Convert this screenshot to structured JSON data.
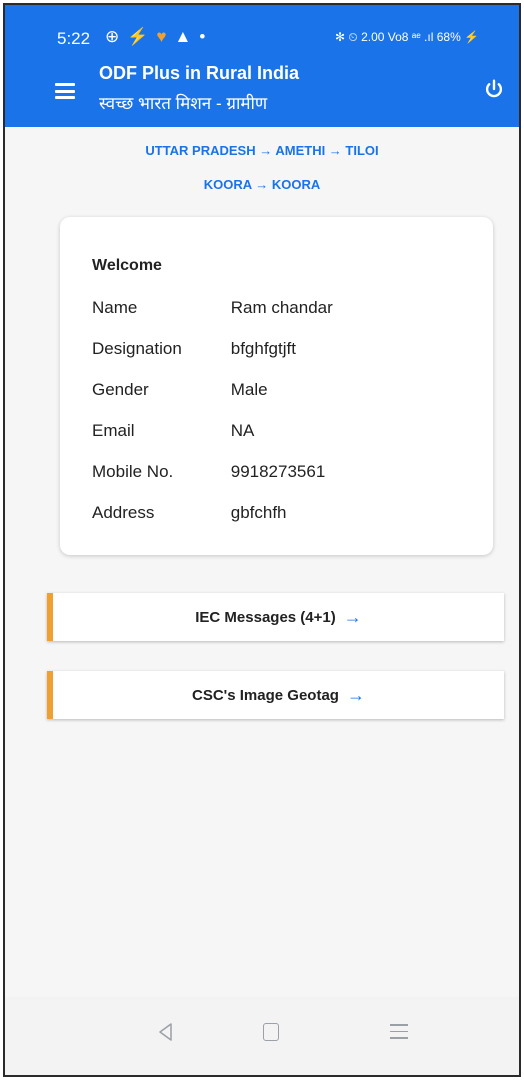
{
  "status_bar": {
    "time": "5:22",
    "left_icons": [
      "⊕",
      "⚡",
      "♥",
      "▲",
      "•"
    ],
    "right_text": "✻ ⏲ 2.00 Vo8 ᵃᵉ .ıl 68% ⚡"
  },
  "header": {
    "title": "ODF Plus in Rural India",
    "subtitle": "स्वच्छ भारत मिशन - ग्रामीण",
    "menu_icon": "hamburger-icon",
    "power_icon": "power-icon"
  },
  "breadcrumb": {
    "line1": "UTTAR PRADESH → AMETHI → TILOI",
    "line2": "KOORA → KOORA"
  },
  "profile": {
    "heading": "Welcome",
    "rows": [
      {
        "label": "Name",
        "value": "Ram chandar"
      },
      {
        "label": "Designation",
        "value": "bfghfgtjft"
      },
      {
        "label": "Gender",
        "value": "Male"
      },
      {
        "label": "Email",
        "value": "NA"
      },
      {
        "label": "Mobile No.",
        "value": "9918273561"
      },
      {
        "label": "Address",
        "value": "gbfchfh"
      }
    ]
  },
  "menu": [
    {
      "label": "IEC Messages (4+1)",
      "arrow": "→"
    },
    {
      "label": "CSC's Image Geotag",
      "arrow": "→"
    }
  ],
  "colors": {
    "primary": "#1a73e8",
    "accent": "#f0a030"
  }
}
